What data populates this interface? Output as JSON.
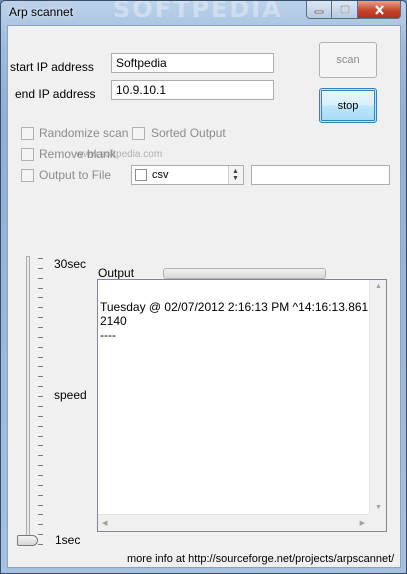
{
  "window": {
    "title": "Arp scannet",
    "watermark": "SOFTPEDIA",
    "controls": {
      "minimize_icon": "minimize-icon",
      "maximize_icon": "maximize-icon",
      "close_icon": "close-icon"
    }
  },
  "form": {
    "start_ip": {
      "label": "start IP address",
      "value": "Softpedia"
    },
    "end_ip": {
      "label": "end IP address",
      "value": "10.9.10.1"
    },
    "scan_button": "scan",
    "stop_button": "stop",
    "options": {
      "randomize_scan": {
        "label": "Randomize scan",
        "checked": false,
        "enabled": false
      },
      "sorted_output": {
        "label": "Sorted Output",
        "checked": false,
        "enabled": false
      },
      "remove_blank": {
        "label": "Remove blank",
        "checked": false,
        "enabled": false
      },
      "output_to_file": {
        "label": "Output to File",
        "checked": false,
        "enabled": false
      }
    },
    "format_select": {
      "value": "csv"
    },
    "file_path": {
      "value": ""
    },
    "overlay_watermark": "www.softpedia.com"
  },
  "speed": {
    "label": "speed",
    "max_label": "30sec",
    "min_label": "1sec",
    "level": 0
  },
  "output": {
    "label": "Output",
    "text": "Tuesday @ 02/07/2012 2:16:13 PM ^14:16:13.8612140\n----",
    "progress_percent": 0
  },
  "footer": {
    "info": "more info at http://sourceforge.net/projects/arpscannet/"
  },
  "colors": {
    "title_bar": "#9fbbdb",
    "close_button": "#c8452f",
    "focus_border": "#3c7fb1"
  }
}
